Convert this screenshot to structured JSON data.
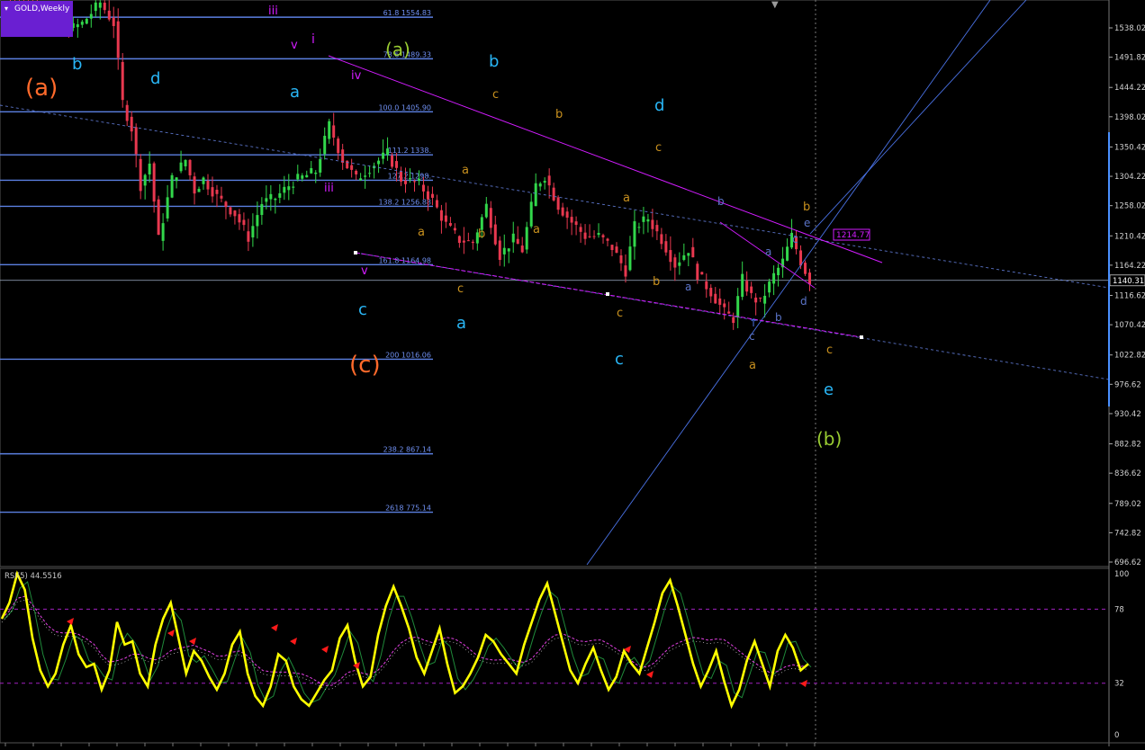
{
  "window": {
    "symbol_label": "GOLD,Weekly",
    "indicator_label": "RSI(5) 44.5516"
  },
  "chart_data": [
    {
      "type": "candlestick",
      "title": "GOLD,Weekly",
      "ylim": [
        676,
        1585
      ],
      "y_ticks": [
        "1538.02",
        "1491.82",
        "1444.22",
        "1398.02",
        "1350.42",
        "1304.22",
        "1258.02",
        "1210.42",
        "1164.22",
        "1116.62",
        "1070.42",
        "1022.82",
        "976.62",
        "930.42",
        "882.82",
        "836.62",
        "789.02",
        "742.82",
        "696.62"
      ],
      "current_price": "1140.31",
      "price_box": "1214.77",
      "price_path": [
        [
          0,
          1605
        ],
        [
          5,
          1580
        ],
        [
          10,
          1560
        ],
        [
          14,
          1532
        ],
        [
          18,
          1545
        ],
        [
          22,
          1578
        ],
        [
          25,
          1545
        ],
        [
          27,
          1420
        ],
        [
          29,
          1380
        ],
        [
          31,
          1290
        ],
        [
          33,
          1325
        ],
        [
          35,
          1205
        ],
        [
          38,
          1300
        ],
        [
          41,
          1330
        ],
        [
          43,
          1282
        ],
        [
          45,
          1300
        ],
        [
          48,
          1272
        ],
        [
          52,
          1245
        ],
        [
          55,
          1208
        ],
        [
          58,
          1262
        ],
        [
          61,
          1270
        ],
        [
          65,
          1296
        ],
        [
          70,
          1312
        ],
        [
          73,
          1385
        ],
        [
          76,
          1330
        ],
        [
          79,
          1300
        ],
        [
          82,
          1318
        ],
        [
          86,
          1340
        ],
        [
          89,
          1300
        ],
        [
          93,
          1292
        ],
        [
          96,
          1266
        ],
        [
          99,
          1228
        ],
        [
          102,
          1204
        ],
        [
          105,
          1200
        ],
        [
          108,
          1258
        ],
        [
          111,
          1180
        ],
        [
          114,
          1205
        ],
        [
          116,
          1188
        ],
        [
          119,
          1290
        ],
        [
          121,
          1305
        ],
        [
          124,
          1258
        ],
        [
          127,
          1232
        ],
        [
          130,
          1210
        ],
        [
          133,
          1210
        ],
        [
          136,
          1192
        ],
        [
          139,
          1155
        ],
        [
          141,
          1225
        ],
        [
          144,
          1238
        ],
        [
          147,
          1205
        ],
        [
          150,
          1165
        ],
        [
          153,
          1190
        ],
        [
          155,
          1150
        ],
        [
          158,
          1122
        ],
        [
          161,
          1090
        ],
        [
          163,
          1080
        ],
        [
          165,
          1142
        ],
        [
          167,
          1115
        ],
        [
          169,
          1105
        ],
        [
          172,
          1148
        ],
        [
          174,
          1170
        ],
        [
          176,
          1210
        ],
        [
          178,
          1170
        ],
        [
          180,
          1140
        ]
      ],
      "fib_levels": [
        {
          "label": "61.8 1554.83",
          "value": 1554.83
        },
        {
          "label": "78.6 1489.33",
          "value": 1489.33
        },
        {
          "label": "100.0 1405.90",
          "value": 1405.9
        },
        {
          "label": "111.2 1338.",
          "value": 1338.0
        },
        {
          "label": "127.2 1298.",
          "value": 1298.0
        },
        {
          "label": "138.2 1256.88",
          "value": 1256.88
        },
        {
          "label": "161.8 1164.98",
          "value": 1164.98
        },
        {
          "label": "200 1016.06",
          "value": 1016.06
        },
        {
          "label": "238.2 867.14",
          "value": 867.14
        },
        {
          "label": "2618 775.14",
          "value": 775.14
        }
      ],
      "wave_labels": [
        {
          "text": "(a)",
          "color": "#ff6a2b"
        },
        {
          "text": "(c)",
          "color": "#ff6a2b"
        },
        {
          "text": "(b)",
          "color": "#9acd32"
        },
        {
          "text": "(a)",
          "color": "#9acd32"
        },
        {
          "text": "b",
          "color": "#29b6f6"
        },
        {
          "text": "d",
          "color": "#29b6f6"
        },
        {
          "text": "a",
          "color": "#29b6f6"
        },
        {
          "text": "b",
          "color": "#29b6f6"
        },
        {
          "text": "d",
          "color": "#29b6f6"
        },
        {
          "text": "c",
          "color": "#29b6f6"
        },
        {
          "text": "a",
          "color": "#29b6f6"
        },
        {
          "text": "c",
          "color": "#29b6f6"
        },
        {
          "text": "e",
          "color": "#29b6f6"
        },
        {
          "text": "iii",
          "color": "#d21cff"
        },
        {
          "text": "v",
          "color": "#d21cff"
        },
        {
          "text": "i",
          "color": "#d21cff"
        },
        {
          "text": "iv",
          "color": "#d21cff"
        },
        {
          "text": "iii",
          "color": "#d21cff"
        },
        {
          "text": "v",
          "color": "#d21cff"
        },
        {
          "text": "c",
          "color": "#c8901e"
        },
        {
          "text": "b",
          "color": "#c8901e"
        },
        {
          "text": "c",
          "color": "#c8901e"
        },
        {
          "text": "a",
          "color": "#c8901e"
        },
        {
          "text": "a",
          "color": "#c8901e"
        },
        {
          "text": "b",
          "color": "#c8901e"
        },
        {
          "text": "a",
          "color": "#c8901e"
        },
        {
          "text": "a",
          "color": "#c8901e"
        },
        {
          "text": "c",
          "color": "#c8901e"
        },
        {
          "text": "b",
          "color": "#c8901e"
        },
        {
          "text": "c",
          "color": "#c8901e"
        },
        {
          "text": "a",
          "color": "#c8901e"
        },
        {
          "text": "b",
          "color": "#c8901e"
        },
        {
          "text": "c",
          "color": "#c8901e"
        },
        {
          "text": "b",
          "color": "#5b74c9"
        },
        {
          "text": "a",
          "color": "#5b74c9"
        },
        {
          "text": "e",
          "color": "#5b74c9"
        },
        {
          "text": "c",
          "color": "#5b74c9"
        },
        {
          "text": "a",
          "color": "#5b74c9"
        },
        {
          "text": "b",
          "color": "#5b74c9"
        },
        {
          "text": "c",
          "color": "#5b74c9"
        },
        {
          "text": "d",
          "color": "#5b74c9"
        }
      ]
    },
    {
      "type": "line",
      "title": "RSI(5) 44.5516",
      "ylim": [
        0,
        100
      ],
      "y_ticks": [
        "100",
        "78",
        "32",
        "0"
      ],
      "levels": [
        78,
        32
      ],
      "series": [
        {
          "color": "#ffff00",
          "values": [
            72,
            82,
            100,
            90,
            60,
            40,
            30,
            38,
            56,
            68,
            50,
            42,
            44,
            28,
            40,
            70,
            56,
            58,
            38,
            30,
            56,
            72,
            82,
            60,
            38,
            52,
            46,
            36,
            28,
            38,
            56,
            64,
            38,
            24,
            18,
            30,
            50,
            46,
            30,
            22,
            18,
            26,
            34,
            40,
            60,
            68,
            46,
            30,
            36,
            62,
            80,
            92,
            80,
            66,
            48,
            38,
            52,
            66,
            44,
            26,
            30,
            38,
            48,
            62,
            58,
            50,
            44,
            38,
            56,
            70,
            84,
            94,
            76,
            58,
            40,
            32,
            44,
            54,
            40,
            28,
            36,
            52,
            44,
            38,
            54,
            70,
            88,
            96,
            80,
            62,
            44,
            30,
            40,
            52,
            34,
            18,
            28,
            46,
            58,
            44,
            30,
            52,
            62,
            54,
            40,
            44
          ]
        }
      ]
    }
  ]
}
